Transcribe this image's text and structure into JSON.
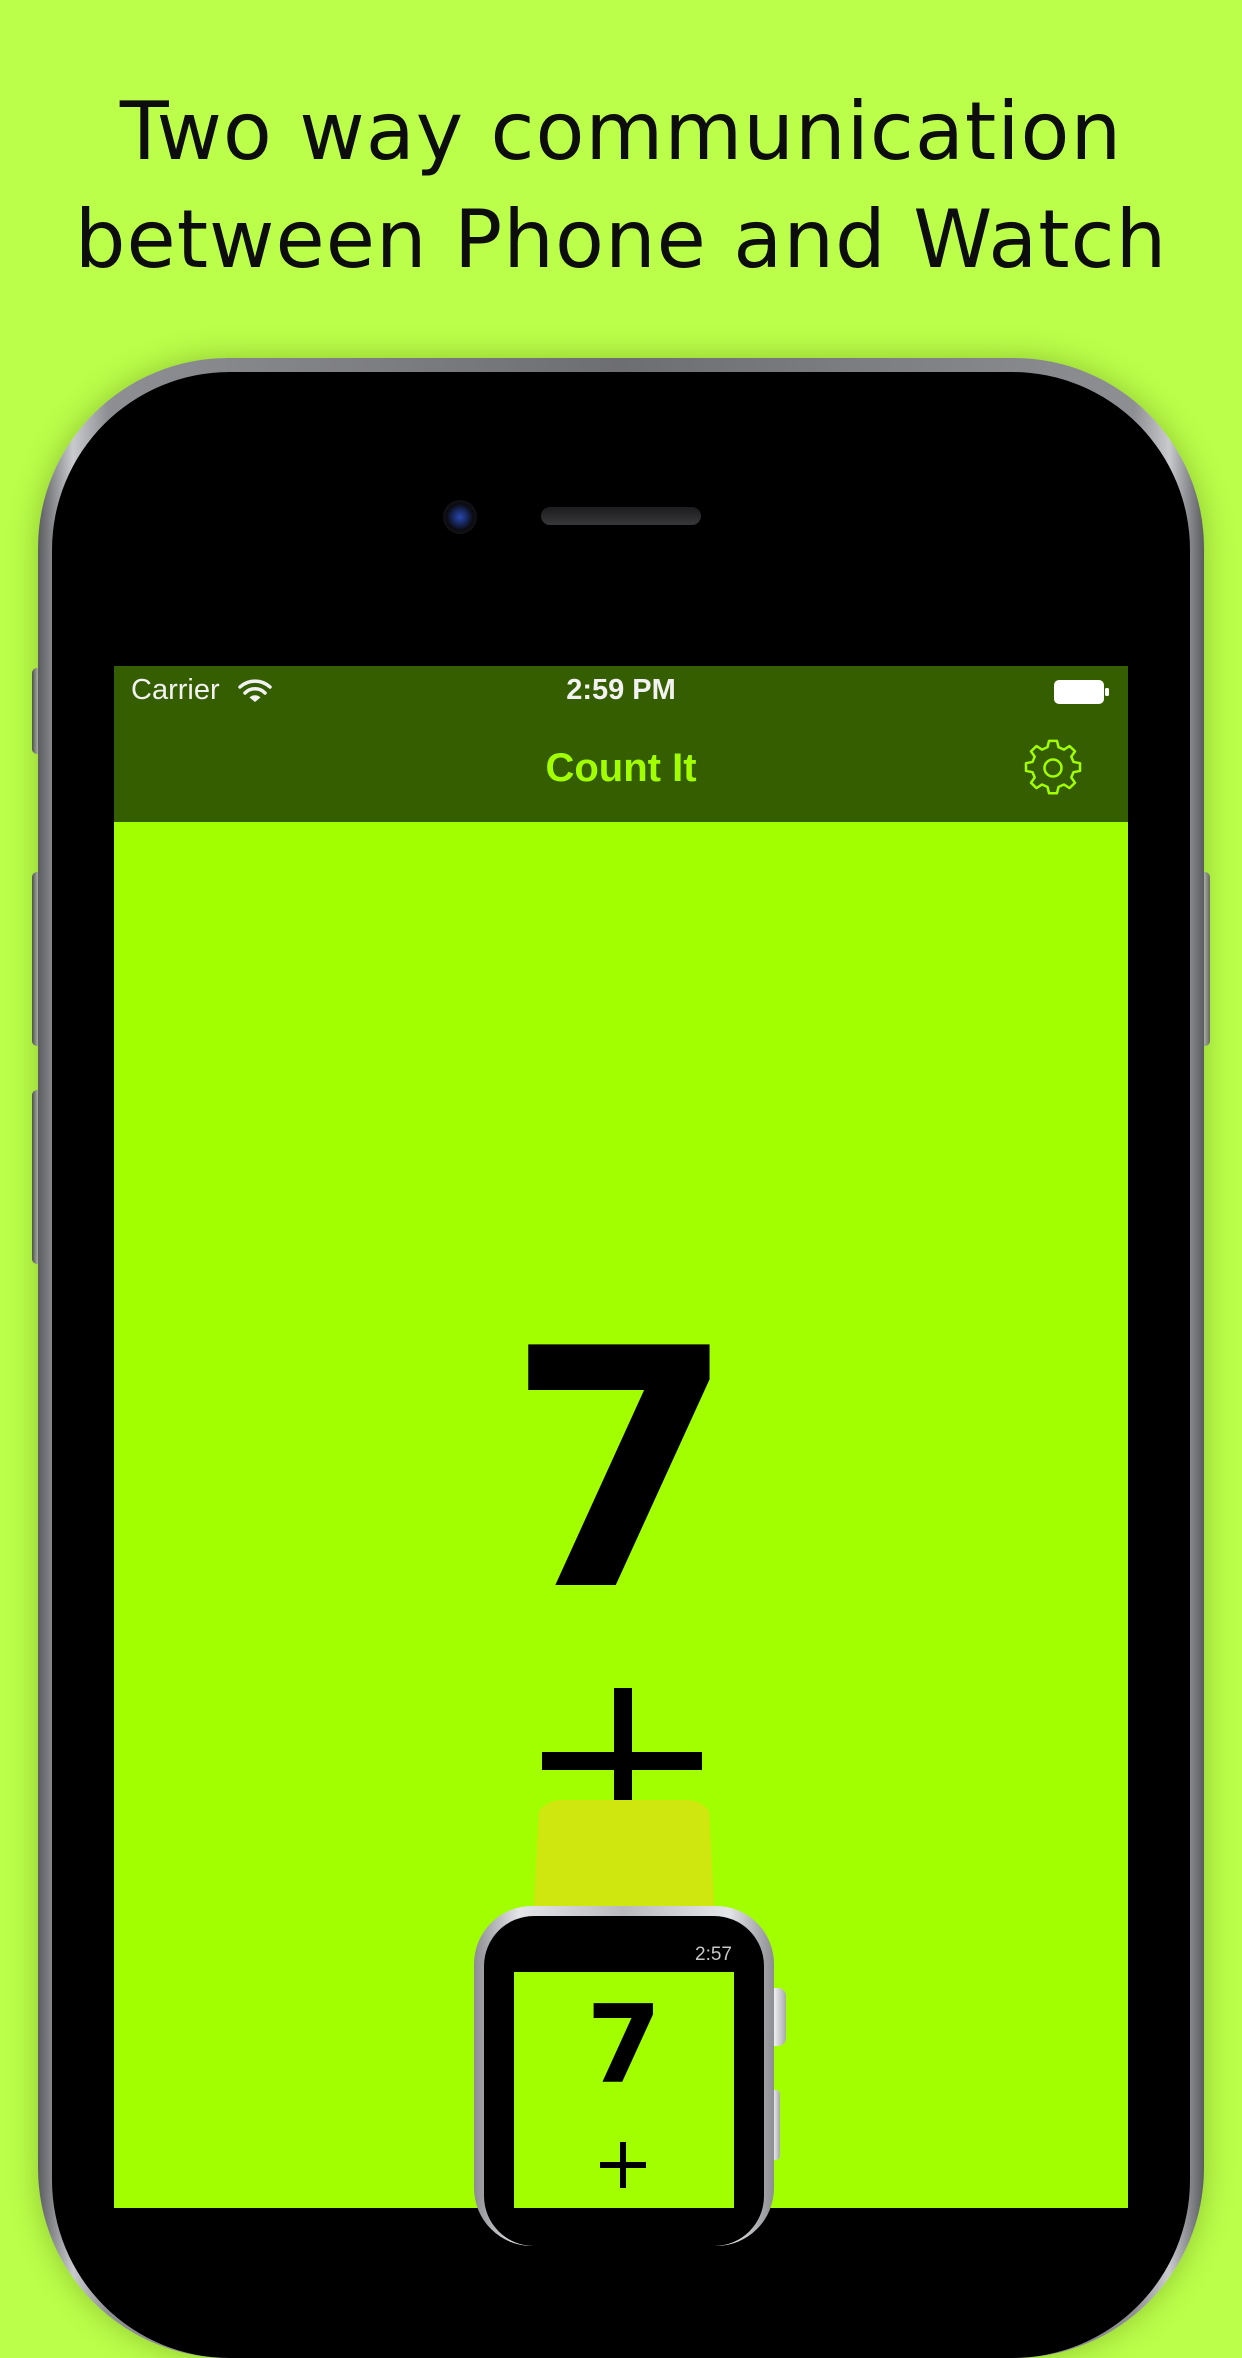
{
  "headline": {
    "line1": "Two way communication",
    "line2": "between Phone and Watch"
  },
  "status_bar": {
    "carrier": "Carrier",
    "time": "2:59 PM",
    "icons": [
      "wifi-icon",
      "battery-icon"
    ]
  },
  "nav": {
    "title": "Count It",
    "settings_icon": "gear-icon"
  },
  "counter": {
    "value": "7",
    "increment_icon": "plus-icon"
  },
  "watch": {
    "time": "2:57",
    "value": "7",
    "increment_icon": "plus-icon"
  },
  "colors": {
    "page_background": "#bbff4a",
    "screen_background": "#a2ff00",
    "nav_background": "#345e00",
    "accent": "#a2ff00",
    "watch_band": "#cfe60f"
  }
}
